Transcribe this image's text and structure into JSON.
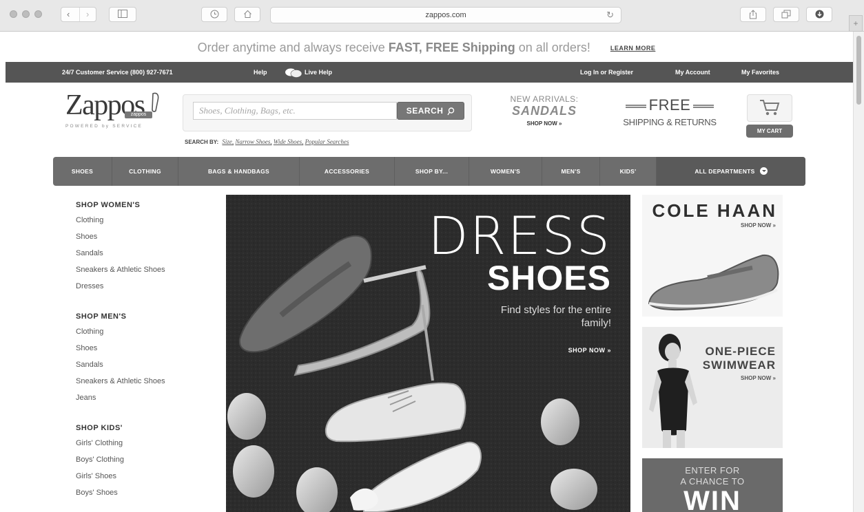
{
  "browser": {
    "url": "zappos.com"
  },
  "promo": {
    "prefix": "Order anytime and always receive ",
    "highlight": "FAST, FREE Shipping",
    "suffix": " on all orders!",
    "learn_more": "LEARN MORE"
  },
  "topbar": {
    "customer_service": "24/7 Customer Service (800) 927-7671",
    "help": "Help",
    "live_help": "Live Help",
    "login": "Log In or Register",
    "my_account": "My Account",
    "my_favorites": "My Favorites"
  },
  "header": {
    "logo": "Zappos",
    "logo_badge": "zappos",
    "logo_tagline": "POWERED by SERVICE",
    "search_placeholder": "Shoes, Clothing, Bags, etc.",
    "search_button": "SEARCH",
    "search_by_label": "SEARCH BY:",
    "search_by_links": [
      "Size,",
      "Narrow Shoes,",
      "Wide Shoes,",
      "Popular Searches"
    ],
    "arrivals_line1": "NEW ARRIVALS:",
    "arrivals_line2": "SANDALS",
    "arrivals_cta": "SHOP NOW »",
    "free_line1": "FREE",
    "free_line2": "SHIPPING & RETURNS",
    "cart_button": "MY CART"
  },
  "nav": {
    "items": [
      "SHOES",
      "CLOTHING",
      "BAGS & HANDBAGS",
      "ACCESSORIES",
      "SHOP BY...",
      "WOMEN'S",
      "MEN'S",
      "KIDS'"
    ],
    "all_departments": "ALL DEPARTMENTS"
  },
  "sidebar": {
    "women_title": "SHOP WOMEN'S",
    "women_links": [
      "Clothing",
      "Shoes",
      "Sandals",
      "Sneakers & Athletic Shoes",
      "Dresses"
    ],
    "men_title": "SHOP MEN'S",
    "men_links": [
      "Clothing",
      "Shoes",
      "Sandals",
      "Sneakers & Athletic Shoes",
      "Jeans"
    ],
    "kids_title": "SHOP KIDS'",
    "kids_links": [
      "Girls' Clothing",
      "Boys' Clothing",
      "Girls' Shoes",
      "Boys' Shoes"
    ]
  },
  "hero": {
    "line1": "DRESS",
    "line2": "SHOES",
    "line3": "Find styles for the entire family!",
    "cta": "SHOP NOW »"
  },
  "ads": {
    "cole_haan": "COLE HAAN",
    "cole_haan_cta": "SHOP NOW »",
    "swim_line1": "ONE-PIECE",
    "swim_line2": "SWIMWEAR",
    "swim_cta": "SHOP NOW »",
    "contest_line1": "ENTER FOR",
    "contest_line2": "A CHANCE TO",
    "contest_big": "WIN"
  }
}
